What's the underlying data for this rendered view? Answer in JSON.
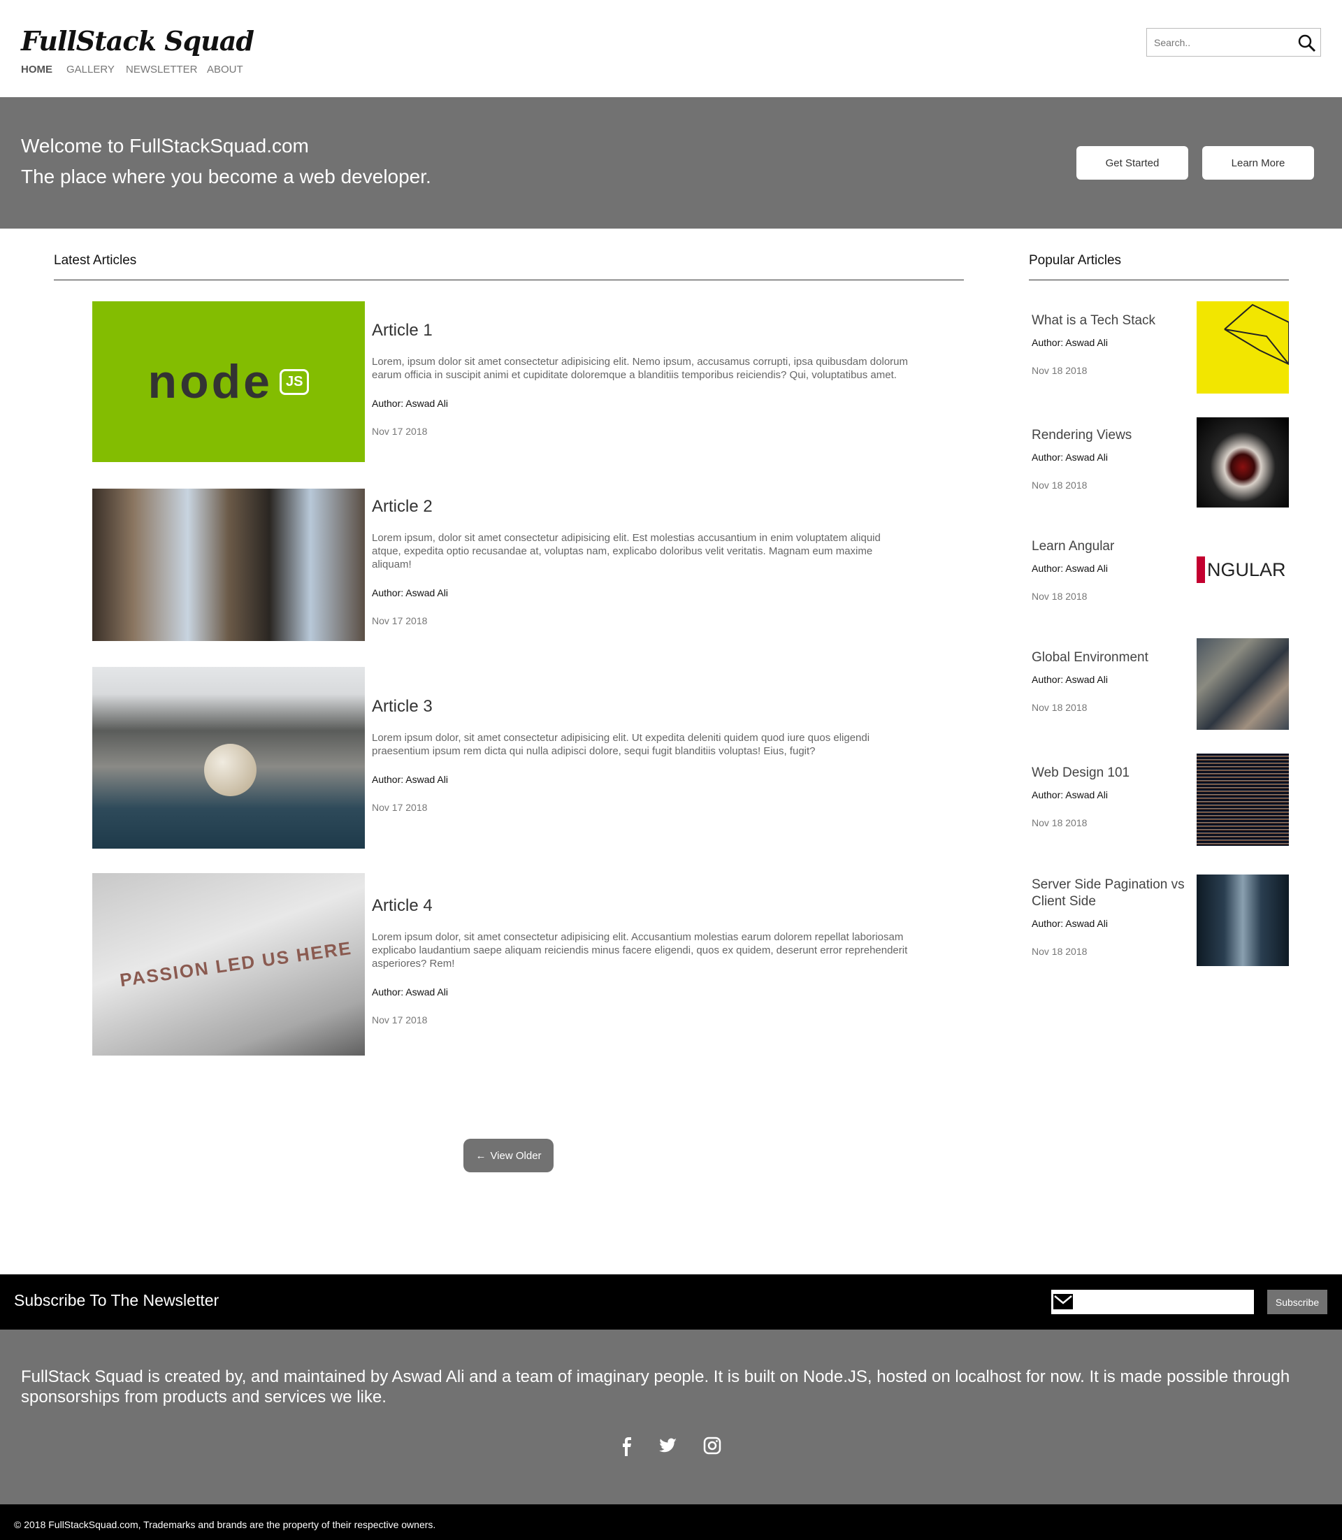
{
  "header": {
    "logo": "FullStack Squad",
    "nav": [
      "HOME",
      "GALLERY",
      "NEWSLETTER",
      "ABOUT"
    ],
    "search_placeholder": "Search.."
  },
  "hero": {
    "line1": "Welcome to FullStackSquad.com",
    "line2": "The place where you become a web developer.",
    "get_started": "Get Started",
    "learn_more": "Learn More"
  },
  "latest": {
    "heading": "Latest Articles",
    "articles": [
      {
        "title": "Article 1",
        "desc": "Lorem, ipsum dolor sit amet consectetur adipisicing elit. Nemo ipsum, accusamus corrupti, ipsa quibusdam dolorum earum officia in suscipit animi et cupiditate doloremque a blanditiis temporibus reiciendis? Qui, voluptatibus amet.",
        "author": "Author: Aswad Ali",
        "date": "Nov 17 2018"
      },
      {
        "title": "Article 2",
        "desc": "Lorem ipsum, dolor sit amet consectetur adipisicing elit. Est molestias accusantium in enim voluptatem aliquid atque, expedita optio recusandae at, voluptas nam, explicabo doloribus velit veritatis. Magnam eum maxime aliquam!",
        "author": "Author: Aswad Ali",
        "date": "Nov 17 2018"
      },
      {
        "title": "Article 3",
        "desc": "Lorem ipsum dolor, sit amet consectetur adipisicing elit. Ut expedita deleniti quidem quod iure quos eligendi praesentium ipsum rem dicta qui nulla adipisci dolore, sequi fugit blanditiis voluptas! Eius, fugit?",
        "author": "Author: Aswad Ali",
        "date": "Nov 17 2018"
      },
      {
        "title": "Article 4",
        "desc": "Lorem ipsum dolor, sit amet consectetur adipisicing elit. Accusantium molestias earum dolorem repellat laboriosam explicabo laudantium saepe aliquam reiciendis minus facere eligendi, quos ex quidem, deserunt error reprehenderit asperiores? Rem!",
        "author": "Author: Aswad Ali",
        "date": "Nov 17 2018"
      }
    ],
    "view_older": "View Older"
  },
  "popular": {
    "heading": "Popular Articles",
    "items": [
      {
        "title": "What is a Tech Stack",
        "author": "Author: Aswad Ali",
        "date": "Nov 18 2018"
      },
      {
        "title": "Rendering Views",
        "author": "Author: Aswad Ali",
        "date": "Nov 18 2018"
      },
      {
        "title": "Learn Angular",
        "author": "Author: Aswad Ali",
        "date": "Nov 18 2018"
      },
      {
        "title": "Global Environment",
        "author": "Author: Aswad Ali",
        "date": "Nov 18 2018"
      },
      {
        "title": "Web Design 101",
        "author": "Author: Aswad Ali",
        "date": "Nov 18 2018"
      },
      {
        "title": "Server Side Pagination vs Client Side",
        "author": "Author: Aswad Ali",
        "date": "Nov 18 2018"
      }
    ]
  },
  "images": {
    "node_logo": "node",
    "passion_text": "PASSION LED US HERE",
    "angular_text": "NGULAR"
  },
  "newsletter": {
    "title": "Subscribe To The Newsletter",
    "button": "Subscribe"
  },
  "footer": {
    "about": "FullStack Squad is created by, and maintained by Aswad Ali and a team of imaginary people. It is built on Node.JS, hosted on localhost for now. It is made possible through sponsorships from products and services we like.",
    "copyright": "© 2018 FullStackSquad.com, Trademarks and brands are the property of their respective owners."
  },
  "colors": {
    "hero": "#727272",
    "node_green": "#83bd01",
    "footer_bar": "#000000"
  }
}
